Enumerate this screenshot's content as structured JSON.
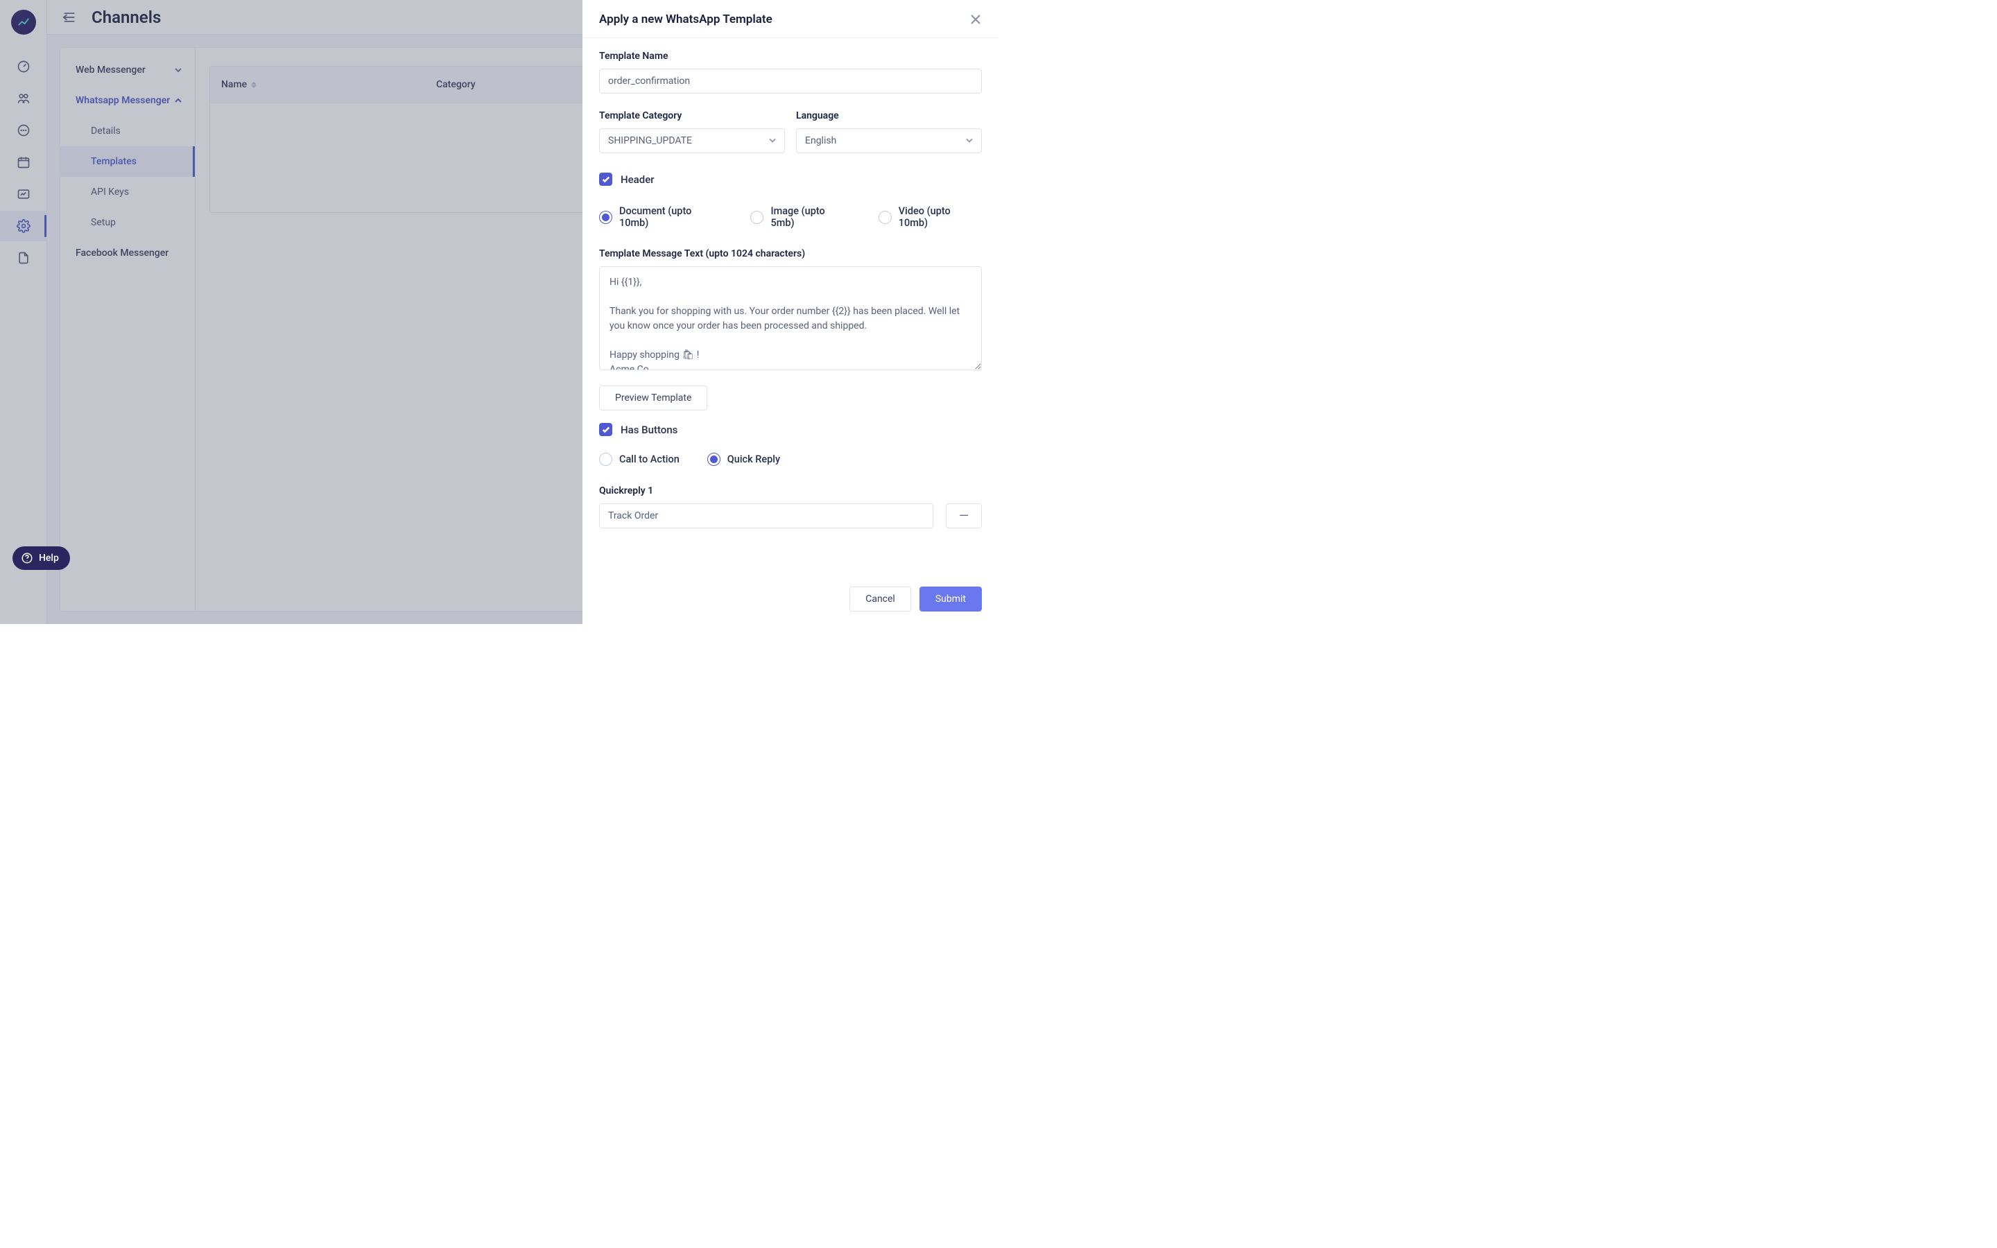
{
  "page_title": "Channels",
  "sidebar": {
    "web_messenger": "Web Messenger",
    "whatsapp_messenger": "Whatsapp Messenger",
    "wa_children": {
      "details": "Details",
      "templates": "Templates",
      "api_keys": "API Keys",
      "setup": "Setup"
    },
    "facebook_messenger": "Facebook Messenger"
  },
  "table": {
    "col_name": "Name",
    "col_category": "Category"
  },
  "help_label": "Help",
  "drawer": {
    "title": "Apply a new WhatsApp Template",
    "template_name_label": "Template Name",
    "template_name_value": "order_confirmation",
    "category_label": "Template Category",
    "category_value": "SHIPPING_UPDATE",
    "language_label": "Language",
    "language_value": "English",
    "header_label": "Header",
    "media": {
      "document": "Document (upto 10mb)",
      "image": "Image (upto 5mb)",
      "video": "Video (upto 10mb)"
    },
    "message_label": "Template Message Text (upto 1024 characters)",
    "message_value": "Hi {{1}},\n\nThank you for shopping with us. Your order number {{2}} has been placed. Well let you know once your order has been processed and shipped.\n\nHappy shopping 🛍 !\nAcme Co.",
    "preview_btn": "Preview Template",
    "has_buttons_label": "Has Buttons",
    "btn_types": {
      "cta": "Call to Action",
      "quick_reply": "Quick Reply"
    },
    "quickreply1_label": "Quickreply 1",
    "quickreply1_value": "Track Order",
    "cancel": "Cancel",
    "submit": "Submit"
  }
}
